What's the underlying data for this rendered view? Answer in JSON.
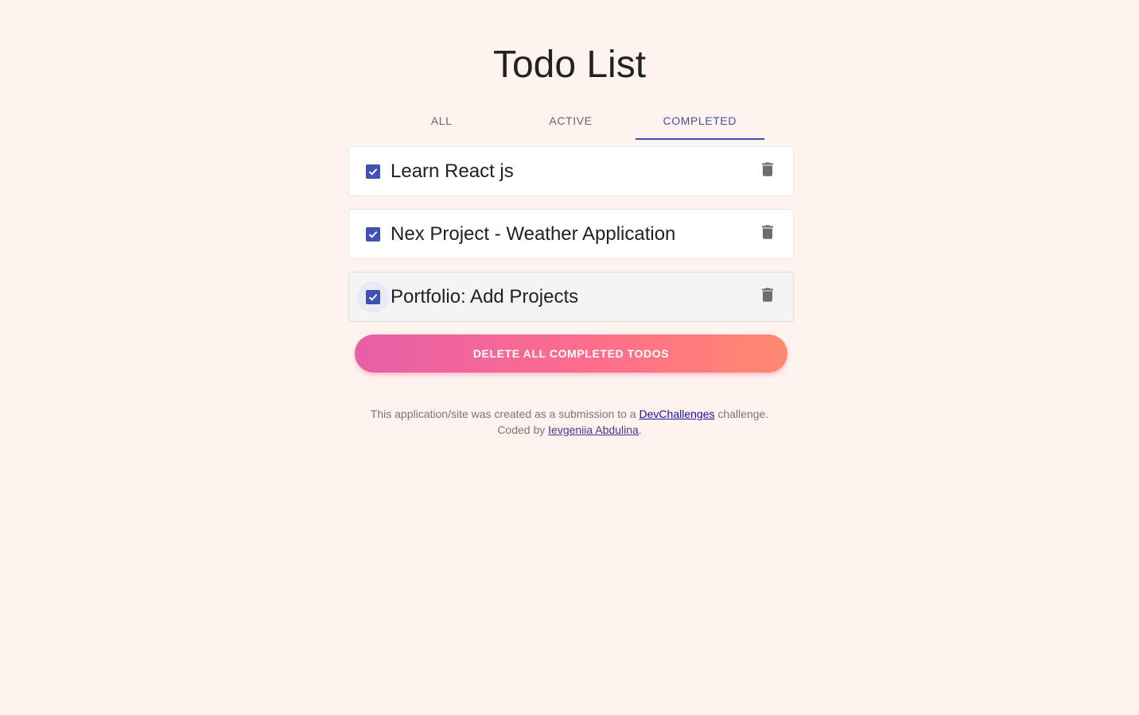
{
  "header": {
    "title": "Todo List"
  },
  "tabs": [
    {
      "label": "ALL"
    },
    {
      "label": "ACTIVE"
    },
    {
      "label": "COMPLETED",
      "active": true
    }
  ],
  "todos": [
    {
      "text": "Learn React js",
      "completed": true
    },
    {
      "text": "Nex Project - Weather Application",
      "completed": true
    },
    {
      "text": "Portfolio: Add Projects",
      "completed": true
    }
  ],
  "actions": {
    "delete_all_label": "DELETE ALL COMPLETED TODOS"
  },
  "footer": {
    "line1_before": "This application/site was created as a submission to a ",
    "line1_link": "DevChallenges",
    "line1_after": " challenge.",
    "line2_before": "Coded by ",
    "line2_link": "Ievgeniia Abdulina",
    "line2_after": "."
  },
  "icons": {
    "checkbox": "checkbox-checked-icon",
    "delete": "trash-icon"
  },
  "colors": {
    "background": "#fff3f0",
    "accent": "#3f51b5",
    "button_gradient_start": "#e65fa8",
    "button_gradient_end": "#ff8a70"
  }
}
